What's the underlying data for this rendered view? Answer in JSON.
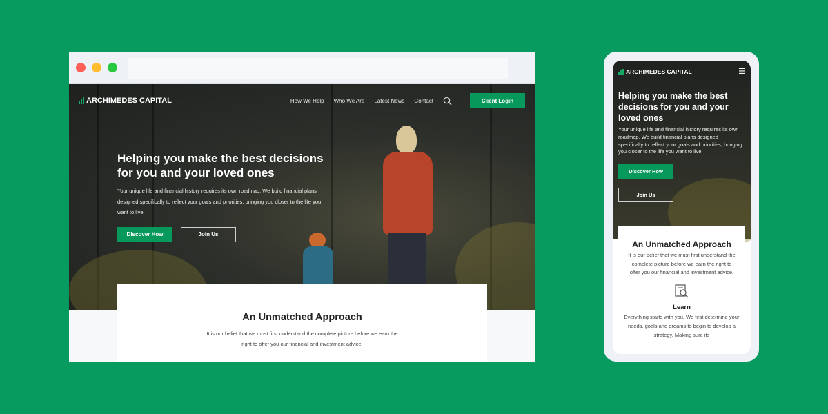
{
  "brand": "ARCHIMEDES CAPITAL",
  "colors": {
    "background": "#079b60",
    "accent": "#07985c"
  },
  "desktop": {
    "nav": [
      "How We Help",
      "Who We Are",
      "Latest News",
      "Contact"
    ],
    "login": "Client Login",
    "hero": {
      "title": "Helping you make the best decisions for you and your loved ones",
      "text": "Your unique life and financial history requires its own roadmap. We build financial plans designed specifically to reflect your goals and priorities, bringing you closer to the life you want to live.",
      "primary": "Discover How",
      "secondary": "Join Us"
    },
    "section": {
      "title": "An Unmatched Approach",
      "text": "It is our belief that we must first understand the complete picture before we earn the right to offer you our financial and investment advice."
    }
  },
  "mobile": {
    "hero": {
      "title": "Helping you make the best decisions for you and your loved ones",
      "text": "Your unique life and financial history requires its own roadmap. We build financial plans designed specifically to reflect your goals and priorities, bringing you closer to the life you want to live.",
      "primary": "Discover How",
      "secondary": "Join Us"
    },
    "section": {
      "title": "An Unmatched Approach",
      "text": "It is our belief that we must first understand the complete picture before we earn the right to offer you our financial and investment advice."
    },
    "feature": {
      "title": "Learn",
      "text": "Everything starts with you. We first determine your needs, goals and dreams to begin to develop a strategy. Making sure its"
    }
  }
}
